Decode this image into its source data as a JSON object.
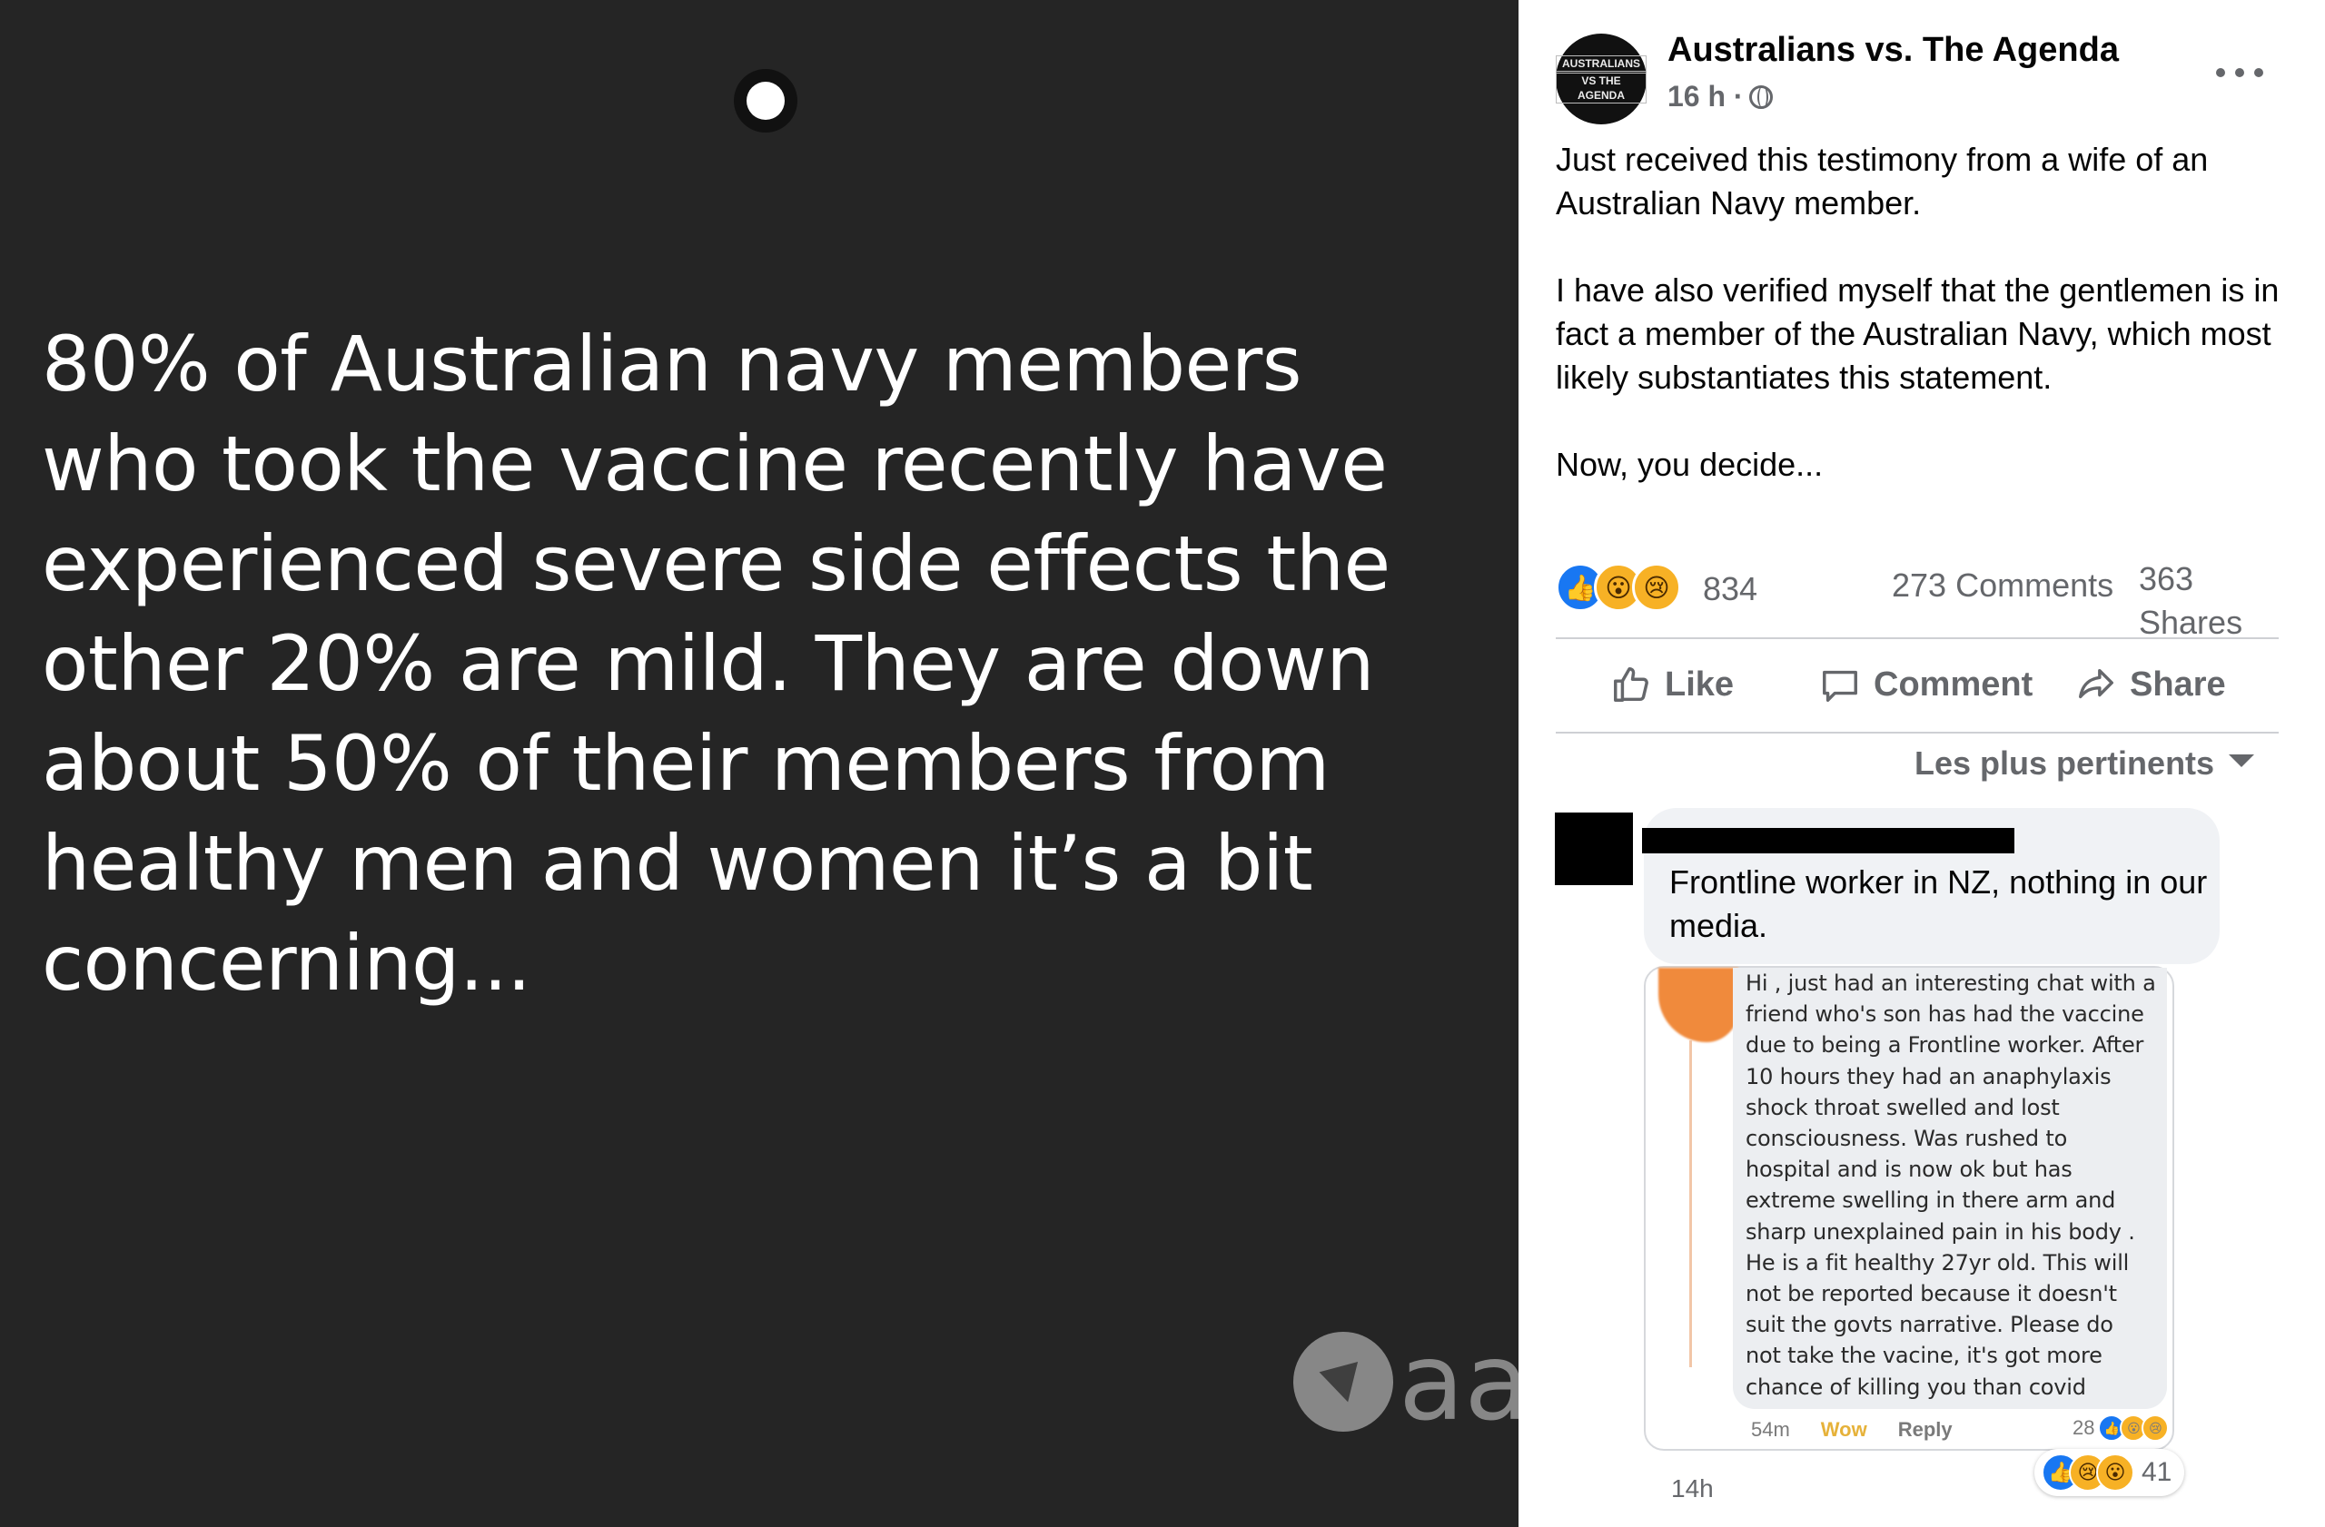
{
  "story": {
    "text": "80% of Australian navy members who took the vaccine recently have experienced severe side effects the other 20% are mild. They are down about 50% of their members from healthy men and women it’s a bit concerning...",
    "watermark": "aa"
  },
  "post": {
    "page_name": "Australians vs. The Agenda",
    "avatar_text": [
      "AUSTRALIANS",
      "VS THE AGENDA"
    ],
    "time": "16 h ·",
    "paragraphs": [
      "Just received this testimony from a wife of an Australian Navy member.",
      "I have also verified myself that the gentlemen is in fact a member of the Australian Navy, which most likely substantiates this statement.",
      "Now, you decide..."
    ],
    "reaction_count": "834",
    "comments": "273 Comments",
    "shares": "363 Shares",
    "actions": {
      "like": "Like",
      "comment": "Comment",
      "share": "Share"
    },
    "sort_label": "Les plus pertinents"
  },
  "comment": {
    "text": "Frontline worker in NZ, nothing in our media.",
    "time": "14h",
    "reaction_count": "41",
    "screenshot": {
      "text": "Hi , just had an interesting chat with a\nfriend who's son has had the vaccine\ndue to being a Frontline worker. After\n10 hours they had an anaphylaxis\nshock throat swelled and lost\nconsciousness.  Was rushed to\nhospital and is now ok but has\nextreme swelling in there arm and\nsharp unexplained pain in his body .\nHe is a fit healthy 27yr old. This will\nnot be reported because it doesn't\nsuit the govts narrative.  Please do\nnot take the vacine,  it's got more\nchance of killing you than covid",
      "time": "54m",
      "wow": "Wow",
      "reply": "Reply",
      "count": "28"
    }
  },
  "colors": {
    "story_bg": "#252525",
    "like_blue": "#1877f2",
    "emoji_yellow": "#f7b125",
    "meta_gray": "#65676b"
  }
}
